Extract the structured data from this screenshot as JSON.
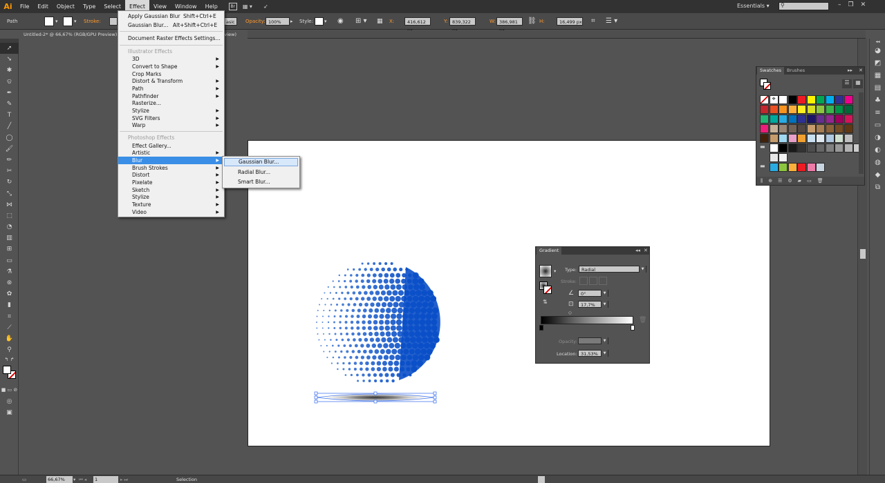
{
  "app": {
    "logo": "Ai"
  },
  "menubar": {
    "items": [
      "File",
      "Edit",
      "Object",
      "Type",
      "Select",
      "Effect",
      "View",
      "Window",
      "Help"
    ],
    "bridge_label": "Br",
    "workspace": "Essentials"
  },
  "controlbar": {
    "selection_type": "Path",
    "stroke_label": "Stroke:",
    "style_basic": "asic",
    "opacity_label": "Opacity:",
    "opacity_value": "100%",
    "style_label": "Style:",
    "x_label": "X:",
    "x_value": "416,612 px",
    "y_label": "Y:",
    "y_value": "839,322 px",
    "w_label": "W:",
    "w_value": "386,981 px",
    "h_label": "H:",
    "h_value": "16,499 px"
  },
  "document": {
    "tab_title": "Untitled-2* @ 66,67% (RGB/GPU Preview)",
    "tab_tail": "review)"
  },
  "effect_menu": {
    "apply_last": {
      "label": "Apply Gaussian Blur",
      "shortcut": "Shift+Ctrl+E"
    },
    "last_effect": {
      "label": "Gaussian Blur...",
      "shortcut": "Alt+Shift+Ctrl+E"
    },
    "raster_settings": "Document Raster Effects Settings...",
    "illustrator_header": "Illustrator Effects",
    "illustrator_items": [
      "3D",
      "Convert to Shape",
      "Crop Marks",
      "Distort & Transform",
      "Path",
      "Pathfinder",
      "Rasterize...",
      "Stylize",
      "SVG Filters",
      "Warp"
    ],
    "photoshop_header": "Photoshop Effects",
    "photoshop_items": [
      "Effect Gallery...",
      "Artistic",
      "Blur",
      "Brush Strokes",
      "Distort",
      "Pixelate",
      "Sketch",
      "Stylize",
      "Texture",
      "Video"
    ]
  },
  "blur_submenu": {
    "items": [
      "Gaussian Blur...",
      "Radial Blur...",
      "Smart Blur..."
    ]
  },
  "swatches_panel": {
    "tabs": [
      "Swatches",
      "Brushes"
    ]
  },
  "gradient_panel": {
    "title": "Gradient",
    "type_label": "Type:",
    "type_value": "Radial",
    "stroke_label": "Stroke:",
    "angle_value": "0°",
    "aspect_value": "17,7%",
    "opacity_label": "Opacity:",
    "location_label": "Location:",
    "location_value": "31,53%"
  },
  "statusbar": {
    "zoom": "66,67%",
    "page": "1",
    "tool": "Selection"
  },
  "colors": {
    "highlight": "#3a8ee6",
    "sphere_light": "#5b8bd8",
    "sphere_dark": "#0a4fc8",
    "app_logo": "#ff9a00"
  }
}
